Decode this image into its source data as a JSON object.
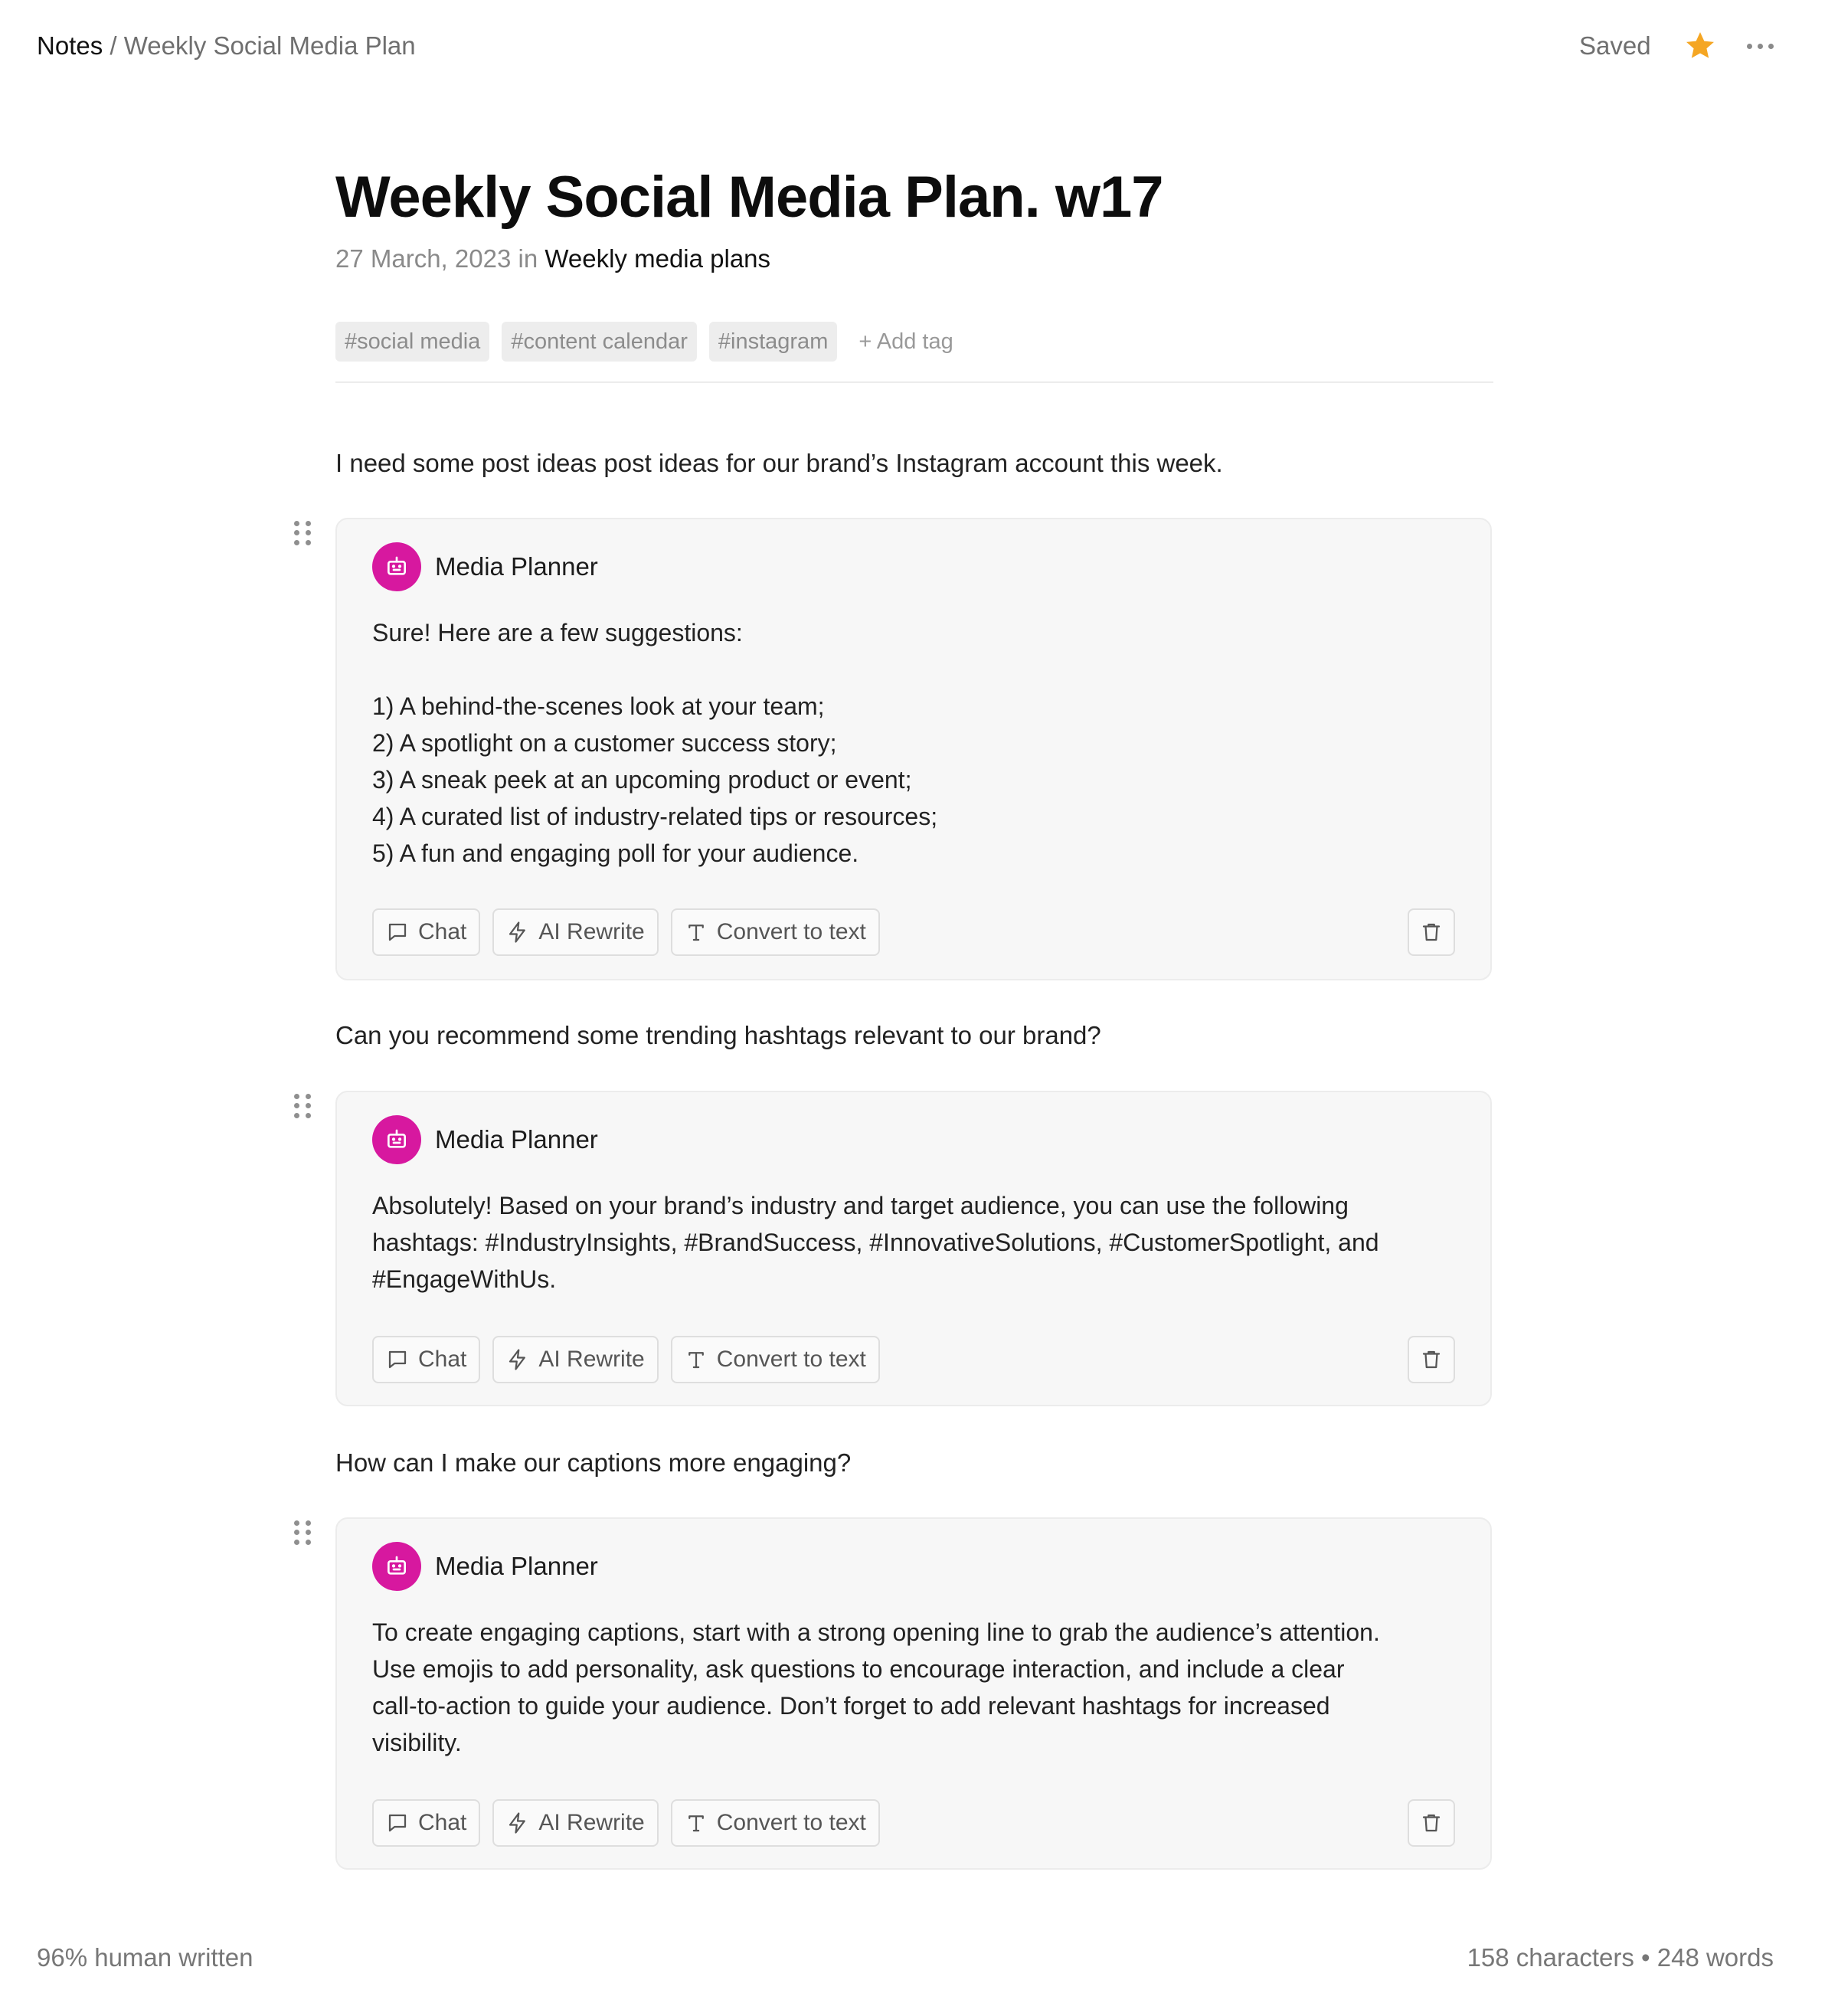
{
  "header": {
    "breadcrumb_root": "Notes",
    "breadcrumb_separator": "/",
    "breadcrumb_current": "Weekly Social Media Plan",
    "status": "Saved",
    "favorite_icon": "star-icon",
    "favorite_color": "#F5A623",
    "more_icon": "more-horizontal-icon"
  },
  "note": {
    "title": "Weekly Social Media Plan. w17",
    "date": "27 March, 2023",
    "in_label": "in",
    "folder": "Weekly media plans",
    "tags": [
      "#social media",
      "#content calendar",
      "#instagram"
    ],
    "add_tag_label": "+ Add tag"
  },
  "accent_color": "#D7189F",
  "conversation": [
    {
      "prompt": "I need some post ideas post ideas for our brand’s Instagram account this week.",
      "agent_name": "Media Planner",
      "reply": "Sure! Here are a few suggestions:\n\n1) A behind-the-scenes look at your team;\n2) A spotlight on a customer success story;\n3) A sneak peek at an upcoming product or event;\n4) A curated list of industry-related tips or resources;\n5) A fun and engaging poll for your audience."
    },
    {
      "prompt": "Can you recommend some trending hashtags relevant to our brand?",
      "agent_name": "Media Planner",
      "reply": "Absolutely! Based on your brand’s industry and target audience, you can use the following\nhashtags: #IndustryInsights, #BrandSuccess, #InnovativeSolutions, #CustomerSpotlight, and\n#EngageWithUs."
    },
    {
      "prompt": "How can I make our captions more engaging?",
      "agent_name": "Media Planner",
      "reply": "To create engaging captions, start with a strong opening line to grab the audience’s attention.\nUse emojis to add personality, ask questions to encourage interaction, and include a clear\ncall-to-action to guide your audience. Don’t forget to add relevant hashtags for increased\nvisibility."
    }
  ],
  "actions": {
    "chat": "Chat",
    "ai_rewrite": "AI Rewrite",
    "convert": "Convert to text"
  },
  "footer": {
    "human_written": "96% human written",
    "stats": "158 characters • 248 words"
  }
}
